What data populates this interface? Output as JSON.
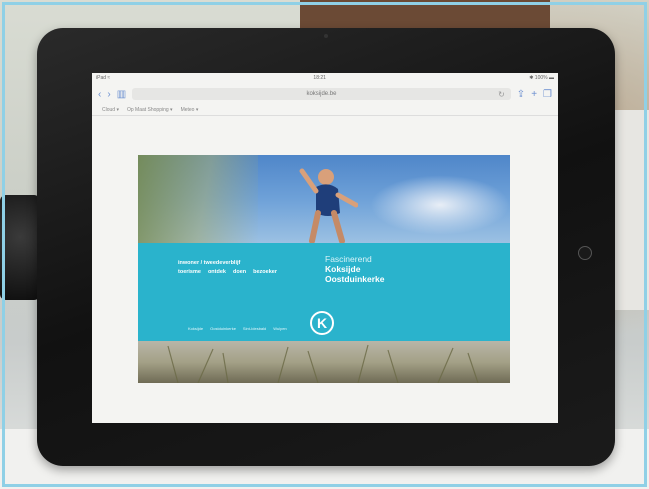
{
  "browser": {
    "url": "koksijde.be",
    "bookmarks": [
      "Cloud ▾",
      "Op Maat Shopping ▾",
      "Meteo ▾"
    ],
    "status_left": "iPad ≈",
    "status_center": "18:21",
    "status_right": "✱ 100% ▬"
  },
  "site": {
    "nav_row1": [
      "inwoner / tweedeverblijf"
    ],
    "nav_row2": [
      "toerisme",
      "ontdek",
      "doen",
      "bezoeker"
    ],
    "brand_line1": "Fascinerend",
    "brand_line2": "Koksijde",
    "brand_line3": "Oostduinkerke",
    "footer_links": [
      "Koksijde",
      "Oostduinkerke",
      "Sint-Idesbald",
      "Wulpen"
    ],
    "logo_letter": "K"
  },
  "colors": {
    "teal": "#2ab3cc",
    "safari_blue": "#6b8fd0"
  }
}
